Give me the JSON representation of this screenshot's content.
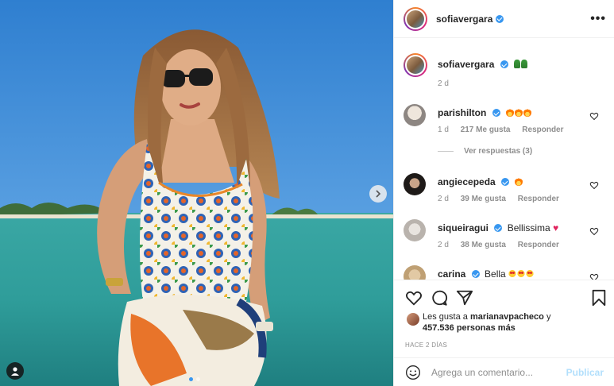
{
  "colors": {
    "accent": "#3897f0",
    "text": "#262626",
    "muted": "#8e8e8e",
    "publish_disabled": "#b2dffc",
    "heart_red": "#e0245e"
  },
  "photo": {
    "carousel_position": 1,
    "carousel_total": 2,
    "icons": {
      "user_tags": "user-icon",
      "next": "chevron-right-icon"
    }
  },
  "header": {
    "username": "sofiavergara",
    "verified": true,
    "more_label": "•••"
  },
  "caption": {
    "username": "sofiavergara",
    "emoji": "plant-emojis",
    "time": "2 d"
  },
  "comments": [
    {
      "username": "parishilton",
      "text": "",
      "emoji": "fire x3",
      "time": "1 d",
      "likes": "217 Me gusta",
      "reply": "Responder"
    },
    {
      "username": "angiecepeda",
      "text": "",
      "emoji": "fire",
      "time": "2 d",
      "likes": "39 Me gusta",
      "reply": "Responder"
    },
    {
      "username": "siqueiragui",
      "text": "Bellissima",
      "emoji": "red-heart",
      "time": "2 d",
      "likes": "38 Me gusta",
      "reply": "Responder"
    },
    {
      "username": "carina",
      "text": "Bella",
      "emoji": "heart-eyes x3",
      "time": "",
      "likes": "",
      "reply": ""
    }
  ],
  "view_replies": "Ver respuestas (3)",
  "likes": {
    "prefix": "Les gusta a",
    "user": "marianavpacheco",
    "conj": "y",
    "count": "457.536 personas más"
  },
  "posted_ago": "HACE 2 DÍAS",
  "add_comment": {
    "placeholder": "Agrega un comentario...",
    "publish_label": "Publicar"
  },
  "action_icons": [
    "heart-icon",
    "comment-icon",
    "share-icon",
    "bookmark-icon"
  ]
}
